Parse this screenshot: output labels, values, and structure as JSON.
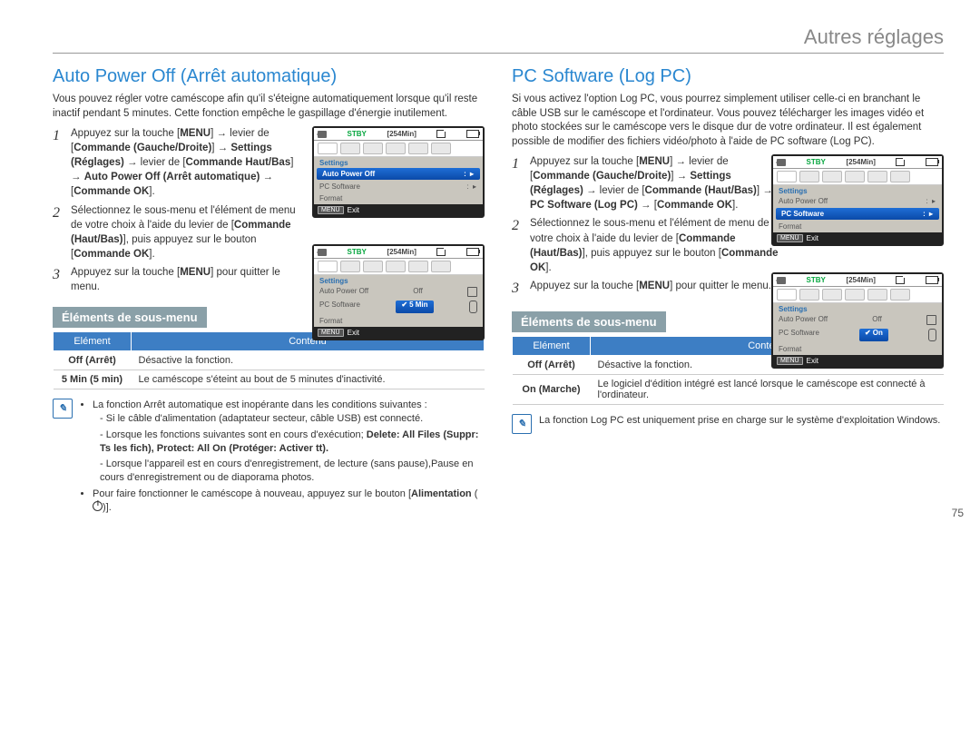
{
  "page": {
    "header": "Autres réglages",
    "number": "75"
  },
  "left": {
    "heading": "Auto Power Off (Arrêt automatique)",
    "intro": "Vous pouvez régler votre caméscope afin qu'il s'éteigne automatiquement lorsque qu'il reste inactif pendant 5 minutes. Cette fonction empêche le gaspillage d'énergie inutilement.",
    "steps": {
      "s1": {
        "num": "1",
        "text": "Appuyez sur la touche [<b>MENU</b>] → levier de [<b>Commande (Gauche/Droite)</b>] → <b>Settings (Réglages)</b> → levier de [<b>Commande Haut/Bas</b>] → <b>Auto Power Off (Arrêt automatique)</b> → [<b>Commande OK</b>]."
      },
      "s2": {
        "num": "2",
        "text": "Sélectionnez le sous-menu et l'élément de menu de votre choix à l'aide du levier de [<b>Commande (Haut/Bas)</b>], puis appuyez sur le bouton [<b>Commande OK</b>]."
      },
      "s3": {
        "num": "3",
        "text": "Appuyez sur la touche [<b>MENU</b>] pour quitter le menu."
      }
    },
    "shot1": {
      "stby": "STBY",
      "min": "[254Min]",
      "menu": "Settings",
      "row_sel": "Auto Power Off",
      "row2": "PC Software",
      "row3": "Format",
      "foot": "Exit"
    },
    "shot2": {
      "stby": "STBY",
      "min": "[254Min]",
      "menu": "Settings",
      "row1": "Auto Power Off",
      "row1v": "Off",
      "row2": "PC Software",
      "row2v": "5 Min",
      "row3": "Format",
      "foot": "Exit"
    },
    "subhead": "Éléments de sous-menu",
    "table": {
      "h1": "Elément",
      "h2": "Contenu",
      "r1k": "Off (Arrêt)",
      "r1v": "Désactive la fonction.",
      "r2k": "5 Min (5 min)",
      "r2v": "Le caméscope s'éteint au bout de 5 minutes d'inactivité."
    },
    "note": {
      "b1": "La fonction Arrêt automatique est inopérante dans les conditions suivantes :",
      "d1": "Si le câble d'alimentation (adaptateur secteur, câble USB) est connecté.",
      "d2": "Lorsque les fonctions suivantes sont en cours d'exécution;",
      "d2b": "Delete: All Files (Suppr: Ts les fich), Protect: All On (Protéger: Activer tt).",
      "d3": "Lorsque l'appareil est en cours d'enregistrement, de lecture (sans pause),Pause en cours d'enregistrement ou de diaporama photos.",
      "b2_pre": "Pour faire fonctionner le caméscope à nouveau, appuyez sur le bouton [",
      "b2_label": "Alimentation",
      "b2_post": ")]."
    }
  },
  "right": {
    "heading": "PC Software (Log PC)",
    "intro": "Si vous activez l'option Log PC, vous pourrez simplement utiliser celle-ci en branchant le câble USB sur le caméscope et l'ordinateur. Vous pouvez télécharger les images vidéo et photo stockées sur le caméscope vers le disque dur de votre ordinateur. Il est également possible de modifier des fichiers vidéo/photo à l'aide de PC software (Log PC).",
    "steps": {
      "s1": {
        "num": "1",
        "text": "Appuyez sur la touche [<b>MENU</b>] → levier de [<b>Commande (Gauche/Droite)</b>] → <b>Settings (Réglages)</b> → levier de [<b>Commande (Haut/Bas)</b>] → <b>PC Software (Log PC)</b> → [<b>Commande OK</b>]."
      },
      "s2": {
        "num": "2",
        "text": "Sélectionnez le sous-menu et l'élément de menu de votre choix à l'aide du levier de [<b>Commande (Haut/Bas)</b>], puis appuyez sur le bouton [<b>Commande OK</b>]."
      },
      "s3": {
        "num": "3",
        "text": "Appuyez sur la touche [<b>MENU</b>] pour quitter le menu."
      }
    },
    "shot1": {
      "stby": "STBY",
      "min": "[254Min]",
      "menu": "Settings",
      "row1": "Auto Power Off",
      "row_sel": "PC Software",
      "row3": "Format",
      "foot": "Exit"
    },
    "shot2": {
      "stby": "STBY",
      "min": "[254Min]",
      "menu": "Settings",
      "row1": "Auto Power Off",
      "row1v": "Off",
      "row2": "PC Software",
      "row2v": "On",
      "row3": "Format",
      "foot": "Exit"
    },
    "subhead": "Éléments de sous-menu",
    "table": {
      "h1": "Elément",
      "h2": "Contenu",
      "r1k": "Off (Arrêt)",
      "r1v": "Désactive la fonction.",
      "r2k": "On (Marche)",
      "r2v": "Le logiciel d'édition intégré est lancé lorsque le caméscope est connecté à l'ordinateur."
    },
    "note": "La fonction Log PC est uniquement prise en charge sur le système d'exploitation Windows."
  }
}
